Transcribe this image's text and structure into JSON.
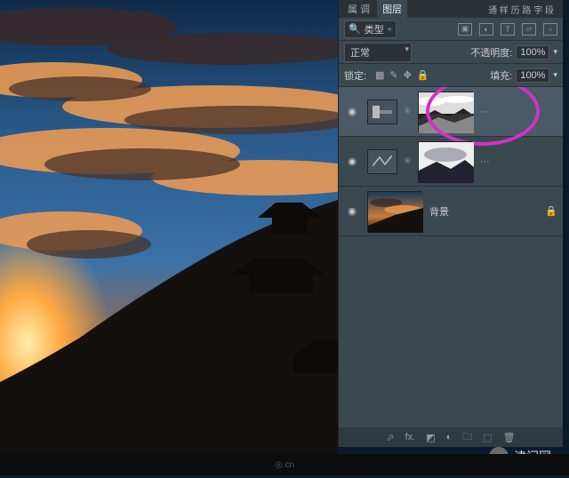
{
  "tabs": {
    "t0": "属 调",
    "t1": "图层",
    "t2": "通 样 历 路 字 段"
  },
  "filter": {
    "search_label": "类型"
  },
  "blend": {
    "mode": "正常",
    "opacity_label": "不透明度:",
    "opacity_value": "100%"
  },
  "lock": {
    "label": "锁定:",
    "fill_label": "填充:",
    "fill_value": "100%"
  },
  "layers": [
    {
      "type": "adjustment",
      "selected": true
    },
    {
      "type": "adjustment",
      "selected": false
    },
    {
      "type": "image",
      "name": "背景",
      "locked": true
    }
  ],
  "watermark": "津门网"
}
